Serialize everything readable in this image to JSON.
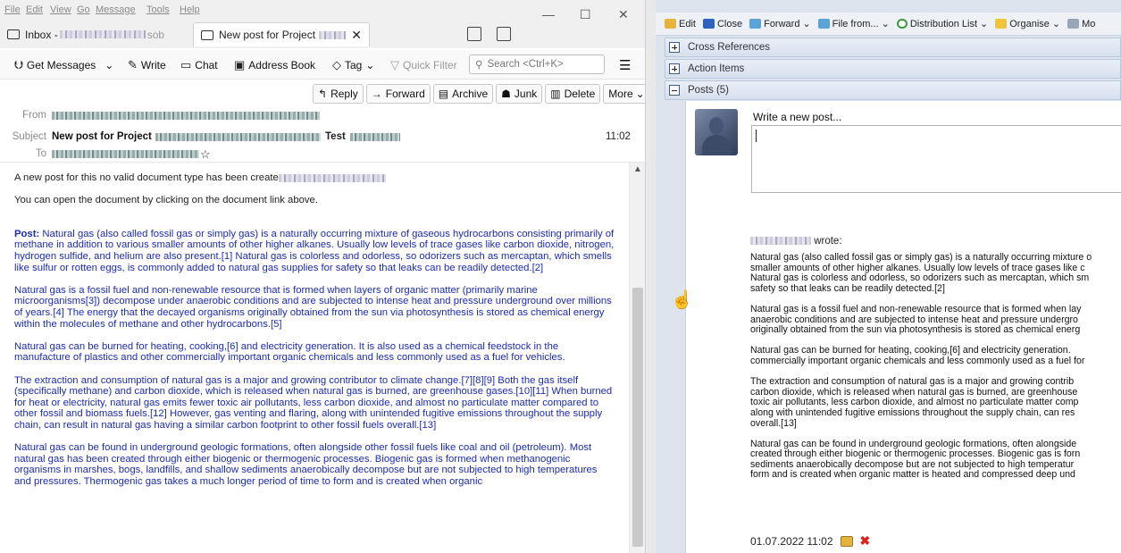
{
  "mail": {
    "menu": [
      "File",
      "Edit",
      "View",
      "Go",
      "Message",
      "Tools",
      "Help"
    ],
    "window_controls": [
      "—",
      "☐",
      "✕"
    ],
    "tabs": {
      "inbox_label": "Inbox - ",
      "inbox_suffix": "sob",
      "post_label": "New post for Project",
      "close": "✕"
    },
    "toolbar": {
      "get_messages": "Get Messages",
      "write": "Write",
      "chat": "Chat",
      "address_book": "Address Book",
      "tag": "Tag",
      "quick_filter": "Quick Filter",
      "search_placeholder": "Search <Ctrl+K>",
      "menu_glyph": "☰"
    },
    "message_buttons": {
      "reply": "Reply",
      "forward": "Forward",
      "archive": "Archive",
      "junk": "Junk",
      "delete": "Delete",
      "more": "More"
    },
    "header": {
      "from_label": "From",
      "subject_label": "Subject",
      "to_label": "To",
      "subject_text": "New post for Project",
      "subject_tail": "Test",
      "time": "11:02",
      "star_glyph": "☆"
    },
    "body": {
      "line1": "A new post for this no valid document type has been create",
      "line2": "You can open the document by clicking on the document link above.",
      "post_label": "Post:",
      "para1": " Natural gas (also called fossil gas or simply gas) is a naturally occurring mixture of gaseous hydrocarbons consisting primarily of methane in addition to various smaller amounts of other higher alkanes. Usually low levels of trace gases like carbon dioxide, nitrogen, hydrogen sulfide, and helium are also present.[1] Natural gas is colorless and odorless, so odorizers such as mercaptan, which smells like sulfur or rotten eggs, is commonly added to natural gas supplies for safety so that leaks can be readily detected.[2]",
      "para2": "Natural gas is a fossil fuel and non-renewable resource that is formed when layers of organic matter (primarily marine microorganisms[3]) decompose under anaerobic conditions and are subjected to intense heat and pressure underground over millions of years.[4] The energy that the decayed organisms originally obtained from the sun via photosynthesis is stored as chemical energy within the molecules of methane and other hydrocarbons.[5]",
      "para3": "Natural gas can be burned for heating, cooking,[6] and electricity generation. It is also used as a chemical feedstock in the manufacture of plastics and other commercially important organic chemicals and less commonly used as a fuel for vehicles.",
      "para4": "The extraction and consumption of natural gas is a major and growing contributor to climate change.[7][8][9] Both the gas itself (specifically methane) and carbon dioxide, which is released when natural gas is burned, are greenhouse gases.[10][11] When burned for heat or electricity, natural gas emits fewer toxic air pollutants, less carbon dioxide, and almost no particulate matter compared to other fossil and biomass fuels.[12] However, gas venting and flaring, along with unintended fugitive emissions throughout the supply chain, can result in natural gas having a similar carbon footprint to other fossil fuels overall.[13]",
      "para5": "Natural gas can be found in underground geologic formations, often alongside other fossil fuels like coal and oil (petroleum). Most natural gas has been created through either biogenic or thermogenic processes. Biogenic gas is formed when methanogenic organisms in marshes, bogs, landfills, and shallow sediments anaerobically decompose but are not subjected to high temperatures and pressures. Thermogenic gas takes a much longer period of time to form and is created when organic"
    }
  },
  "docsys": {
    "toolbar": {
      "edit": "Edit",
      "close": "Close",
      "forward": "Forward",
      "file_from": "File from...",
      "distribution_list": "Distribution List",
      "organise": "Organise",
      "more": "Mo"
    },
    "sections": {
      "cross_references": "Cross References",
      "action_items": "Action Items",
      "posts": "Posts (5)"
    },
    "posts": {
      "write_label": "Write a new post...",
      "author_suffix": "wrote:",
      "lines": [
        [
          "Natural gas (also called fossil gas or simply gas) is a naturally occurring mixture o",
          "smaller amounts of other higher alkanes. Usually low levels of trace gases like c",
          "Natural gas is colorless and odorless, so odorizers such as mercaptan, which sm",
          "safety so that leaks can be readily detected.[2]"
        ],
        [
          "Natural gas is a fossil fuel and non-renewable resource that is formed when lay",
          "anaerobic conditions and are subjected to intense heat and pressure undergro",
          "originally obtained from the sun via photosynthesis is stored as chemical energ"
        ],
        [
          "Natural gas can be burned for heating, cooking,[6] and electricity generation.",
          "commercially important organic chemicals and less commonly used as a fuel for"
        ],
        [
          "The extraction and consumption of natural gas is a major and growing contrib",
          "carbon dioxide, which is released when natural gas is burned, are greenhouse",
          "toxic air pollutants, less carbon dioxide, and almost no particulate matter comp",
          "along with unintended fugitive emissions throughout the supply chain, can res",
          "overall.[13]"
        ],
        [
          "Natural gas can be found in underground geologic formations, often alongside",
          "created through either biogenic or thermogenic processes. Biogenic gas is forn",
          "sediments anaerobically decompose but are not subjected to high temperatur",
          "form and is created when organic matter is heated and compressed deep und"
        ]
      ],
      "date": "01.07.2022 11:02",
      "delete_glyph": "✖"
    }
  }
}
